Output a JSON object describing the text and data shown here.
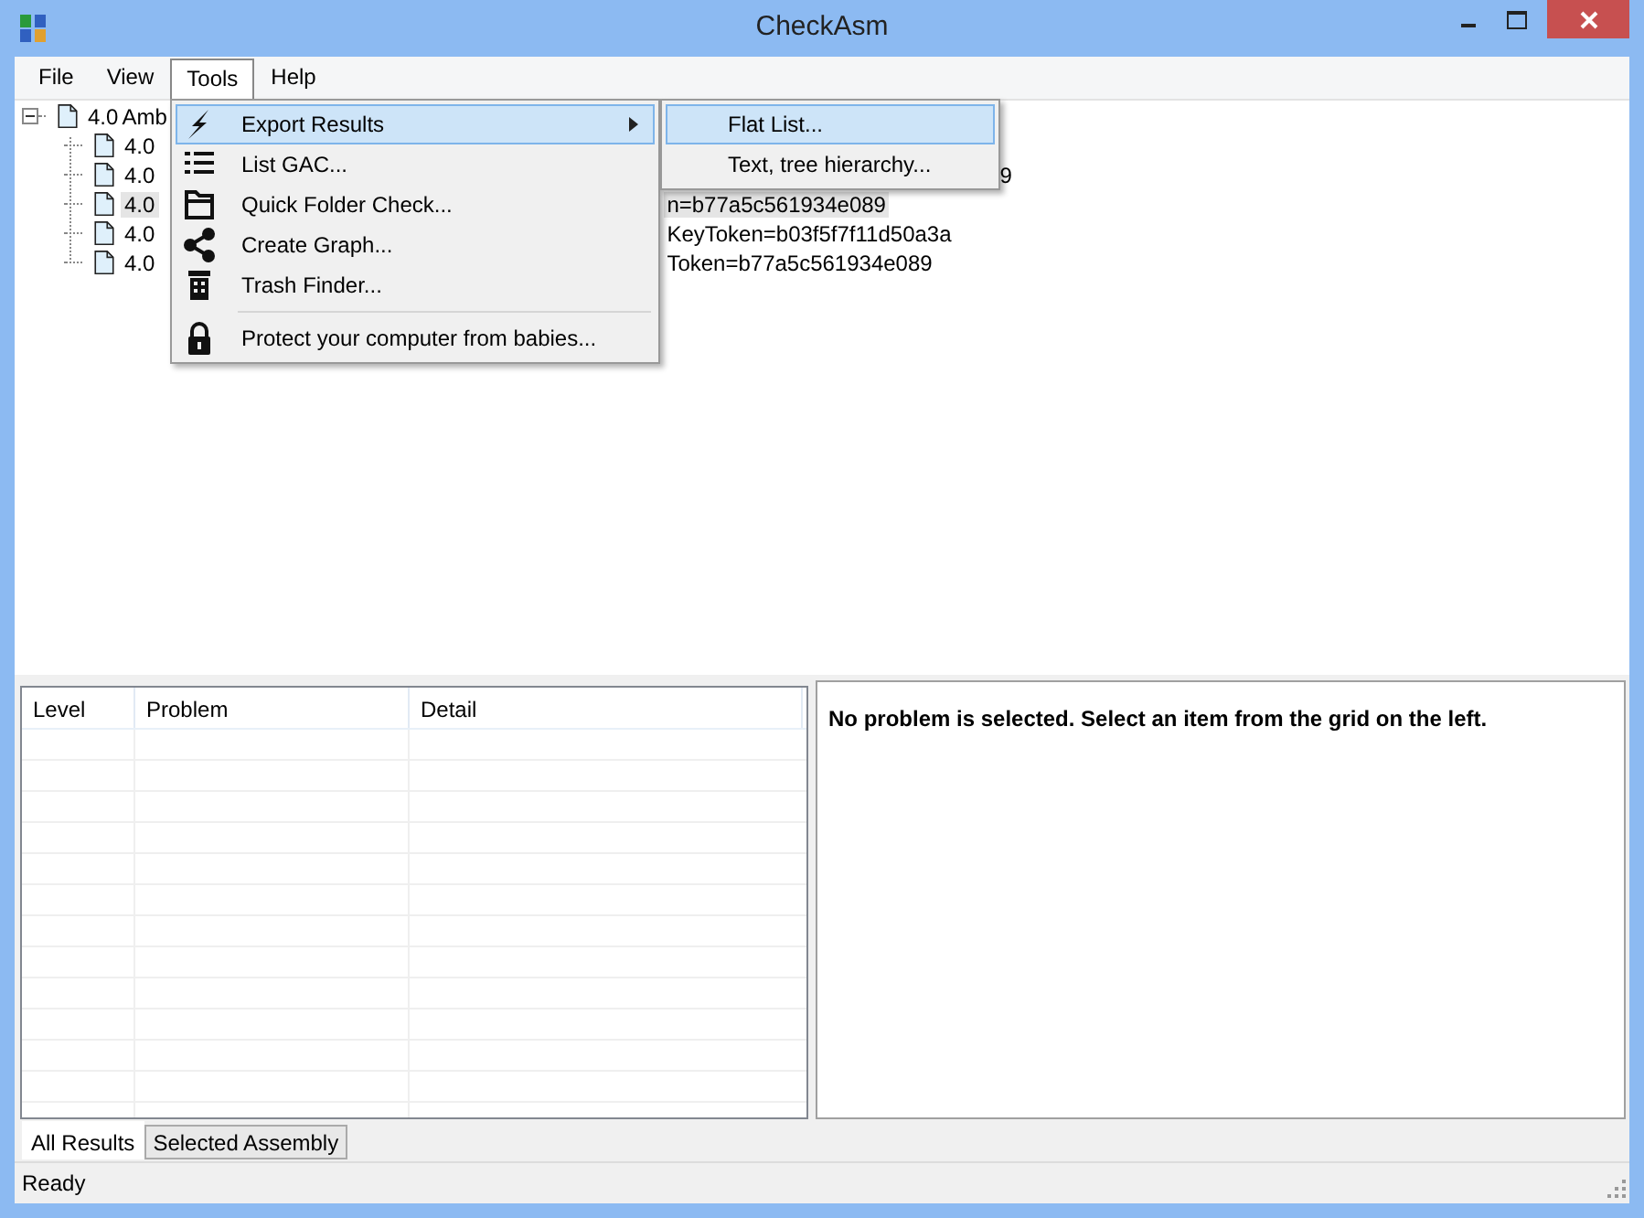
{
  "window": {
    "title": "CheckAsm"
  },
  "menu_bar": [
    {
      "label": "File",
      "selected": false
    },
    {
      "label": "View",
      "selected": false
    },
    {
      "label": "Tools",
      "selected": true
    },
    {
      "label": "Help",
      "selected": false
    }
  ],
  "tree": {
    "label": "4.0",
    "tail": "Amb",
    "expanded": true,
    "selected": false,
    "children": [
      {
        "label": "4.0",
        "selected": false
      },
      {
        "label": "4.0",
        "tail": "9",
        "selected": false
      },
      {
        "label": "4.0",
        "tail": "n=b77a5c561934e089",
        "selected": true
      },
      {
        "label": "4.0",
        "tail": "KeyToken=b03f5f7f11d50a3a",
        "selected": false
      },
      {
        "label": "4.0",
        "tail": "Token=b77a5c561934e089",
        "selected": false
      }
    ]
  },
  "tools_menu": [
    {
      "kind": "item",
      "label": "Export Results",
      "submenu": true,
      "selected": true
    },
    {
      "kind": "item",
      "label": "List GAC...",
      "submenu": false,
      "selected": false
    },
    {
      "kind": "item",
      "label": "Quick Folder Check...",
      "submenu": false,
      "selected": false
    },
    {
      "kind": "item",
      "label": "Create Graph...",
      "submenu": false,
      "selected": false
    },
    {
      "kind": "item",
      "label": "Trash Finder...",
      "submenu": false,
      "selected": false
    },
    {
      "kind": "separator"
    },
    {
      "kind": "item",
      "label": "Protect your computer from babies...",
      "submenu": false,
      "selected": false
    }
  ],
  "export_submenu": [
    {
      "label": "Flat List...",
      "selected": true
    },
    {
      "label": "Text, tree hierarchy...",
      "selected": false
    }
  ],
  "results_grid": {
    "columns": [
      "Level",
      "Problem",
      "Detail"
    ]
  },
  "detail_message": "No problem is selected. Select an item from the grid on the left.",
  "bottom_tabs": [
    {
      "label": "All Results",
      "selected": true
    },
    {
      "label": "Selected Assembly",
      "selected": false
    }
  ],
  "status_bar": "Ready"
}
